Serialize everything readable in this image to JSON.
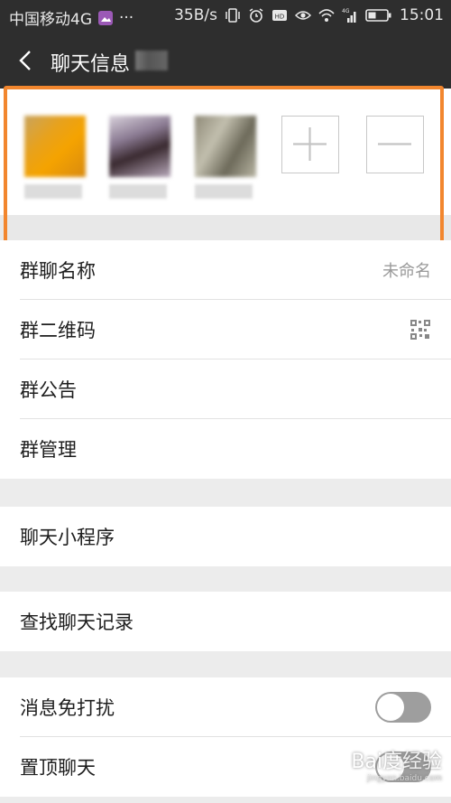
{
  "status_bar": {
    "carrier": "中国移动4G",
    "more": "···",
    "net_speed": "35B/s",
    "network_label": "4G",
    "time": "15:01"
  },
  "header": {
    "title": "聊天信息"
  },
  "members_section": {
    "add_button": "add-member",
    "remove_button": "remove-member"
  },
  "settings": {
    "group1": [
      {
        "label": "群聊名称",
        "value": "未命名"
      },
      {
        "label": "群二维码"
      },
      {
        "label": "群公告"
      },
      {
        "label": "群管理"
      }
    ],
    "group2": [
      {
        "label": "聊天小程序"
      }
    ],
    "group3": [
      {
        "label": "查找聊天记录"
      }
    ],
    "group4": [
      {
        "label": "消息免打扰",
        "toggle": false
      },
      {
        "label": "置顶聊天",
        "toggle": false
      }
    ]
  },
  "watermark": {
    "text": "Bai度经验",
    "sub": "jingyan.baidu.com"
  },
  "colors": {
    "highlight_border": "#f2862e",
    "header_bg": "#2e2e2e",
    "toggle_off": "#9e9e9e"
  }
}
